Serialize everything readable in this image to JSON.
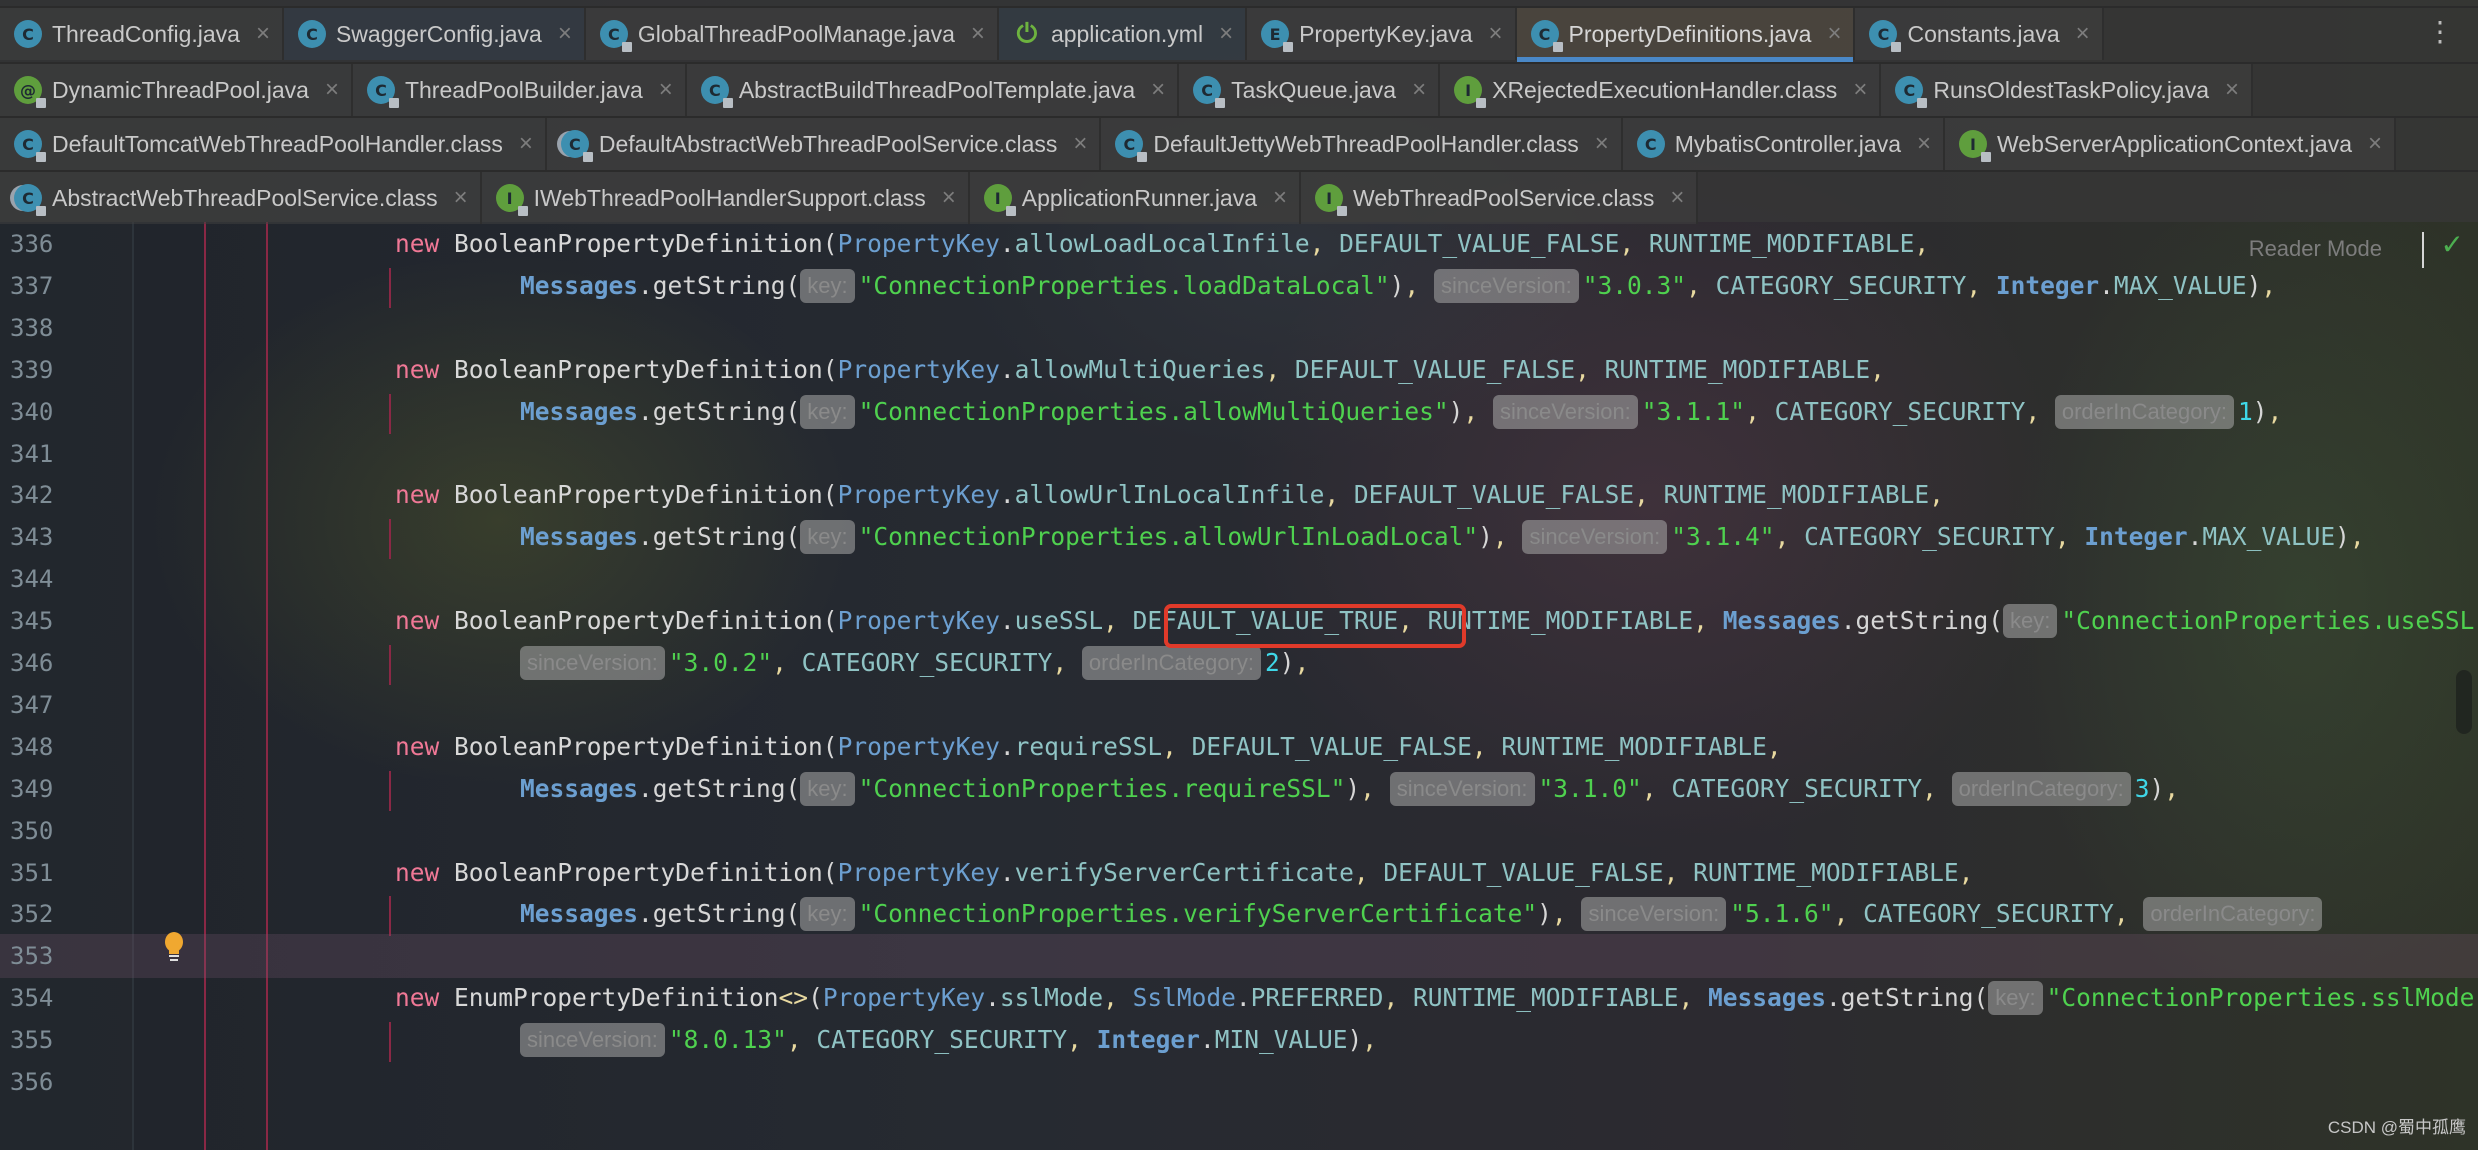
{
  "tabs": {
    "rows": [
      [
        {
          "label": "ThreadConfig.java",
          "icon": "c",
          "lock": false,
          "style": ""
        },
        {
          "label": "SwaggerConfig.java",
          "icon": "c",
          "lock": false,
          "style": "blueish"
        },
        {
          "label": "GlobalThreadPoolManage.java",
          "icon": "c",
          "lock": true,
          "style": ""
        },
        {
          "label": "application.yml",
          "icon": "spring",
          "lock": false,
          "style": "blueish"
        },
        {
          "label": "PropertyKey.java",
          "icon": "e",
          "lock": true,
          "style": ""
        },
        {
          "label": "PropertyDefinitions.java",
          "icon": "c",
          "lock": true,
          "style": "active"
        },
        {
          "label": "Constants.java",
          "icon": "c",
          "lock": true,
          "style": ""
        }
      ],
      [
        {
          "label": "DynamicThreadPool.java",
          "icon": "a",
          "lock": true,
          "style": ""
        },
        {
          "label": "ThreadPoolBuilder.java",
          "icon": "c",
          "lock": true,
          "style": ""
        },
        {
          "label": "AbstractBuildThreadPoolTemplate.java",
          "icon": "c",
          "lock": true,
          "style": ""
        },
        {
          "label": "TaskQueue.java",
          "icon": "c",
          "lock": true,
          "style": ""
        },
        {
          "label": "XRejectedExecutionHandler.class",
          "icon": "i",
          "lock": true,
          "style": ""
        },
        {
          "label": "RunsOldestTaskPolicy.java",
          "icon": "c",
          "lock": true,
          "style": ""
        }
      ],
      [
        {
          "label": "DefaultTomcatWebThreadPoolHandler.class",
          "icon": "c",
          "lock": true,
          "style": ""
        },
        {
          "label": "DefaultAbstractWebThreadPoolService.class",
          "icon": "cb",
          "lock": true,
          "style": ""
        },
        {
          "label": "DefaultJettyWebThreadPoolHandler.class",
          "icon": "c",
          "lock": true,
          "style": ""
        },
        {
          "label": "MybatisController.java",
          "icon": "c",
          "lock": false,
          "style": ""
        },
        {
          "label": "WebServerApplicationContext.java",
          "icon": "i",
          "lock": true,
          "style": ""
        }
      ],
      [
        {
          "label": "AbstractWebThreadPoolService.class",
          "icon": "cb",
          "lock": true,
          "style": ""
        },
        {
          "label": "IWebThreadPoolHandlerSupport.class",
          "icon": "i",
          "lock": true,
          "style": ""
        },
        {
          "label": "ApplicationRunner.java",
          "icon": "i",
          "lock": true,
          "style": ""
        },
        {
          "label": "WebThreadPoolService.class",
          "icon": "i",
          "lock": true,
          "style": ""
        }
      ]
    ],
    "close_glyph": "×",
    "more_glyph": "⋮"
  },
  "icon_letters": {
    "c": "C",
    "cb": "C",
    "i": "I",
    "e": "E",
    "a": "@",
    "spring": "⏻"
  },
  "editor": {
    "reader_mode": "Reader Mode",
    "reader_check": "✓",
    "highlighted_token": "DEFAULT_VALUE_TRUE",
    "lines": [
      {
        "n": "336",
        "indent": 1,
        "tokens": [
          [
            "kw",
            "new"
          ],
          [
            "punc",
            " "
          ],
          [
            "cls",
            "BooleanPropertyDefinition"
          ],
          [
            "punc",
            "("
          ],
          [
            "type",
            "PropertyKey"
          ],
          [
            "punc",
            "."
          ],
          [
            "field",
            "allowLoadLocalInfile"
          ],
          [
            "comma",
            ", "
          ],
          [
            "const",
            "DEFAULT_VALUE_FALSE"
          ],
          [
            "comma",
            ", "
          ],
          [
            "const",
            "RUNTIME_MODIFIABLE"
          ],
          [
            "comma",
            ","
          ]
        ]
      },
      {
        "n": "337",
        "indent": 2,
        "tokens": [
          [
            "type bold",
            "Messages"
          ],
          [
            "punc",
            ".getString("
          ],
          [
            "hint",
            "key:"
          ],
          [
            "str",
            "\"ConnectionProperties.loadDataLocal\""
          ],
          [
            "punc",
            ")"
          ],
          [
            "comma",
            ", "
          ],
          [
            "hint",
            "sinceVersion:"
          ],
          [
            "str",
            "\"3.0.3\""
          ],
          [
            "comma",
            ", "
          ],
          [
            "const",
            "CATEGORY_SECURITY"
          ],
          [
            "comma",
            ", "
          ],
          [
            "type bold",
            "Integer"
          ],
          [
            "punc",
            "."
          ],
          [
            "const",
            "MAX_VALUE"
          ],
          [
            "punc",
            ")"
          ],
          [
            "comma",
            ","
          ]
        ]
      },
      {
        "n": "338",
        "indent": 0,
        "tokens": []
      },
      {
        "n": "339",
        "indent": 1,
        "tokens": [
          [
            "kw",
            "new"
          ],
          [
            "punc",
            " "
          ],
          [
            "cls",
            "BooleanPropertyDefinition"
          ],
          [
            "punc",
            "("
          ],
          [
            "type",
            "PropertyKey"
          ],
          [
            "punc",
            "."
          ],
          [
            "field",
            "allowMultiQueries"
          ],
          [
            "comma",
            ", "
          ],
          [
            "const",
            "DEFAULT_VALUE_FALSE"
          ],
          [
            "comma",
            ", "
          ],
          [
            "const",
            "RUNTIME_MODIFIABLE"
          ],
          [
            "comma",
            ","
          ]
        ]
      },
      {
        "n": "340",
        "indent": 2,
        "tokens": [
          [
            "type bold",
            "Messages"
          ],
          [
            "punc",
            ".getString("
          ],
          [
            "hint",
            "key:"
          ],
          [
            "str",
            "\"ConnectionProperties.allowMultiQueries\""
          ],
          [
            "punc",
            ")"
          ],
          [
            "comma",
            ", "
          ],
          [
            "hint",
            "sinceVersion:"
          ],
          [
            "str",
            "\"3.1.1\""
          ],
          [
            "comma",
            ", "
          ],
          [
            "const",
            "CATEGORY_SECURITY"
          ],
          [
            "comma",
            ", "
          ],
          [
            "hint",
            "orderInCategory:"
          ],
          [
            "num",
            "1"
          ],
          [
            "punc",
            ")"
          ],
          [
            "comma",
            ","
          ]
        ]
      },
      {
        "n": "341",
        "indent": 0,
        "tokens": []
      },
      {
        "n": "342",
        "indent": 1,
        "tokens": [
          [
            "kw",
            "new"
          ],
          [
            "punc",
            " "
          ],
          [
            "cls",
            "BooleanPropertyDefinition"
          ],
          [
            "punc",
            "("
          ],
          [
            "type",
            "PropertyKey"
          ],
          [
            "punc",
            "."
          ],
          [
            "field",
            "allowUrlInLocalInfile"
          ],
          [
            "comma",
            ", "
          ],
          [
            "const",
            "DEFAULT_VALUE_FALSE"
          ],
          [
            "comma",
            ", "
          ],
          [
            "const",
            "RUNTIME_MODIFIABLE"
          ],
          [
            "comma",
            ","
          ]
        ]
      },
      {
        "n": "343",
        "indent": 2,
        "tokens": [
          [
            "type bold",
            "Messages"
          ],
          [
            "punc",
            ".getString("
          ],
          [
            "hint",
            "key:"
          ],
          [
            "str",
            "\"ConnectionProperties.allowUrlInLoadLocal\""
          ],
          [
            "punc",
            ")"
          ],
          [
            "comma",
            ", "
          ],
          [
            "hint",
            "sinceVersion:"
          ],
          [
            "str",
            "\"3.1.4\""
          ],
          [
            "comma",
            ", "
          ],
          [
            "const",
            "CATEGORY_SECURITY"
          ],
          [
            "comma",
            ", "
          ],
          [
            "type bold",
            "Integer"
          ],
          [
            "punc",
            "."
          ],
          [
            "const",
            "MAX_VALUE"
          ],
          [
            "punc",
            ")"
          ],
          [
            "comma",
            ","
          ]
        ]
      },
      {
        "n": "344",
        "indent": 0,
        "tokens": []
      },
      {
        "n": "345",
        "indent": 1,
        "tokens": [
          [
            "kw",
            "new"
          ],
          [
            "punc",
            " "
          ],
          [
            "cls",
            "BooleanPropertyDefinition"
          ],
          [
            "punc",
            "("
          ],
          [
            "type",
            "PropertyKey"
          ],
          [
            "punc",
            "."
          ],
          [
            "field",
            "useSSL"
          ],
          [
            "comma",
            ", "
          ],
          [
            "const",
            "DEFAULT_VALUE_TRUE"
          ],
          [
            "comma",
            ", "
          ],
          [
            "const",
            "RUNTIME_MODIFIABLE"
          ],
          [
            "comma",
            ", "
          ],
          [
            "type bold",
            "Messages"
          ],
          [
            "punc",
            ".getString("
          ],
          [
            "hint",
            "key:"
          ],
          [
            "str",
            "\"ConnectionProperties.useSSL\""
          ],
          [
            "punc",
            ")"
          ],
          [
            "comma",
            ","
          ]
        ]
      },
      {
        "n": "346",
        "indent": 2,
        "tokens": [
          [
            "hint",
            "sinceVersion:"
          ],
          [
            "str",
            "\"3.0.2\""
          ],
          [
            "comma",
            ", "
          ],
          [
            "const",
            "CATEGORY_SECURITY"
          ],
          [
            "comma",
            ", "
          ],
          [
            "hint",
            "orderInCategory:"
          ],
          [
            "num",
            "2"
          ],
          [
            "punc",
            ")"
          ],
          [
            "comma",
            ","
          ]
        ]
      },
      {
        "n": "347",
        "indent": 0,
        "tokens": []
      },
      {
        "n": "348",
        "indent": 1,
        "tokens": [
          [
            "kw",
            "new"
          ],
          [
            "punc",
            " "
          ],
          [
            "cls",
            "BooleanPropertyDefinition"
          ],
          [
            "punc",
            "("
          ],
          [
            "type",
            "PropertyKey"
          ],
          [
            "punc",
            "."
          ],
          [
            "field",
            "requireSSL"
          ],
          [
            "comma",
            ", "
          ],
          [
            "const",
            "DEFAULT_VALUE_FALSE"
          ],
          [
            "comma",
            ", "
          ],
          [
            "const",
            "RUNTIME_MODIFIABLE"
          ],
          [
            "comma",
            ","
          ]
        ]
      },
      {
        "n": "349",
        "indent": 2,
        "tokens": [
          [
            "type bold",
            "Messages"
          ],
          [
            "punc",
            ".getString("
          ],
          [
            "hint",
            "key:"
          ],
          [
            "str",
            "\"ConnectionProperties.requireSSL\""
          ],
          [
            "punc",
            ")"
          ],
          [
            "comma",
            ", "
          ],
          [
            "hint",
            "sinceVersion:"
          ],
          [
            "str",
            "\"3.1.0\""
          ],
          [
            "comma",
            ", "
          ],
          [
            "const",
            "CATEGORY_SECURITY"
          ],
          [
            "comma",
            ", "
          ],
          [
            "hint",
            "orderInCategory:"
          ],
          [
            "num",
            "3"
          ],
          [
            "punc",
            ")"
          ],
          [
            "comma",
            ","
          ]
        ]
      },
      {
        "n": "350",
        "indent": 0,
        "tokens": []
      },
      {
        "n": "351",
        "indent": 1,
        "tokens": [
          [
            "kw",
            "new"
          ],
          [
            "punc",
            " "
          ],
          [
            "cls",
            "BooleanPropertyDefinition"
          ],
          [
            "punc",
            "("
          ],
          [
            "type",
            "PropertyKey"
          ],
          [
            "punc",
            "."
          ],
          [
            "field",
            "verifyServerCertificate"
          ],
          [
            "comma",
            ", "
          ],
          [
            "const",
            "DEFAULT_VALUE_FALSE"
          ],
          [
            "comma",
            ", "
          ],
          [
            "const",
            "RUNTIME_MODIFIABLE"
          ],
          [
            "comma",
            ","
          ]
        ]
      },
      {
        "n": "352",
        "indent": 2,
        "tokens": [
          [
            "type bold",
            "Messages"
          ],
          [
            "punc",
            ".getString("
          ],
          [
            "hint",
            "key:"
          ],
          [
            "str",
            "\"ConnectionProperties.verifyServerCertificate\""
          ],
          [
            "punc",
            ")"
          ],
          [
            "comma",
            ", "
          ],
          [
            "hint",
            "sinceVersion:"
          ],
          [
            "str",
            "\"5.1.6\""
          ],
          [
            "comma",
            ", "
          ],
          [
            "const",
            "CATEGORY_SECURITY"
          ],
          [
            "comma",
            ", "
          ],
          [
            "hint",
            "orderInCategory:"
          ]
        ]
      },
      {
        "n": "353",
        "indent": 0,
        "tokens": [],
        "current": true
      },
      {
        "n": "354",
        "indent": 1,
        "tokens": [
          [
            "kw",
            "new"
          ],
          [
            "punc",
            " "
          ],
          [
            "cls",
            "EnumPropertyDefinition"
          ],
          [
            "comma",
            "<>"
          ],
          [
            "punc",
            "("
          ],
          [
            "type",
            "PropertyKey"
          ],
          [
            "punc",
            "."
          ],
          [
            "field",
            "sslMode"
          ],
          [
            "comma",
            ", "
          ],
          [
            "type",
            "SslMode"
          ],
          [
            "punc",
            "."
          ],
          [
            "const",
            "PREFERRED"
          ],
          [
            "comma",
            ", "
          ],
          [
            "const",
            "RUNTIME_MODIFIABLE"
          ],
          [
            "comma",
            ", "
          ],
          [
            "type bold",
            "Messages"
          ],
          [
            "punc",
            ".getString("
          ],
          [
            "hint",
            "key:"
          ],
          [
            "str",
            "\"ConnectionProperties.sslMode\""
          ]
        ]
      },
      {
        "n": "355",
        "indent": 2,
        "tokens": [
          [
            "hint",
            "sinceVersion:"
          ],
          [
            "str",
            "\"8.0.13\""
          ],
          [
            "comma",
            ", "
          ],
          [
            "const",
            "CATEGORY_SECURITY"
          ],
          [
            "comma",
            ", "
          ],
          [
            "type bold",
            "Integer"
          ],
          [
            "punc",
            "."
          ],
          [
            "const",
            "MIN_VALUE"
          ],
          [
            "punc",
            ")"
          ],
          [
            "comma",
            ","
          ]
        ]
      },
      {
        "n": "356",
        "indent": 0,
        "tokens": []
      }
    ]
  },
  "watermark": "CSDN @蜀中孤鹰",
  "colors": {
    "active_tab_underline": "#4a88c7",
    "highlight_box": "#e03a2a",
    "keyword": "#f07896",
    "string": "#4fd14f",
    "number": "#3fd7e8",
    "type": "#6c9fd0"
  }
}
